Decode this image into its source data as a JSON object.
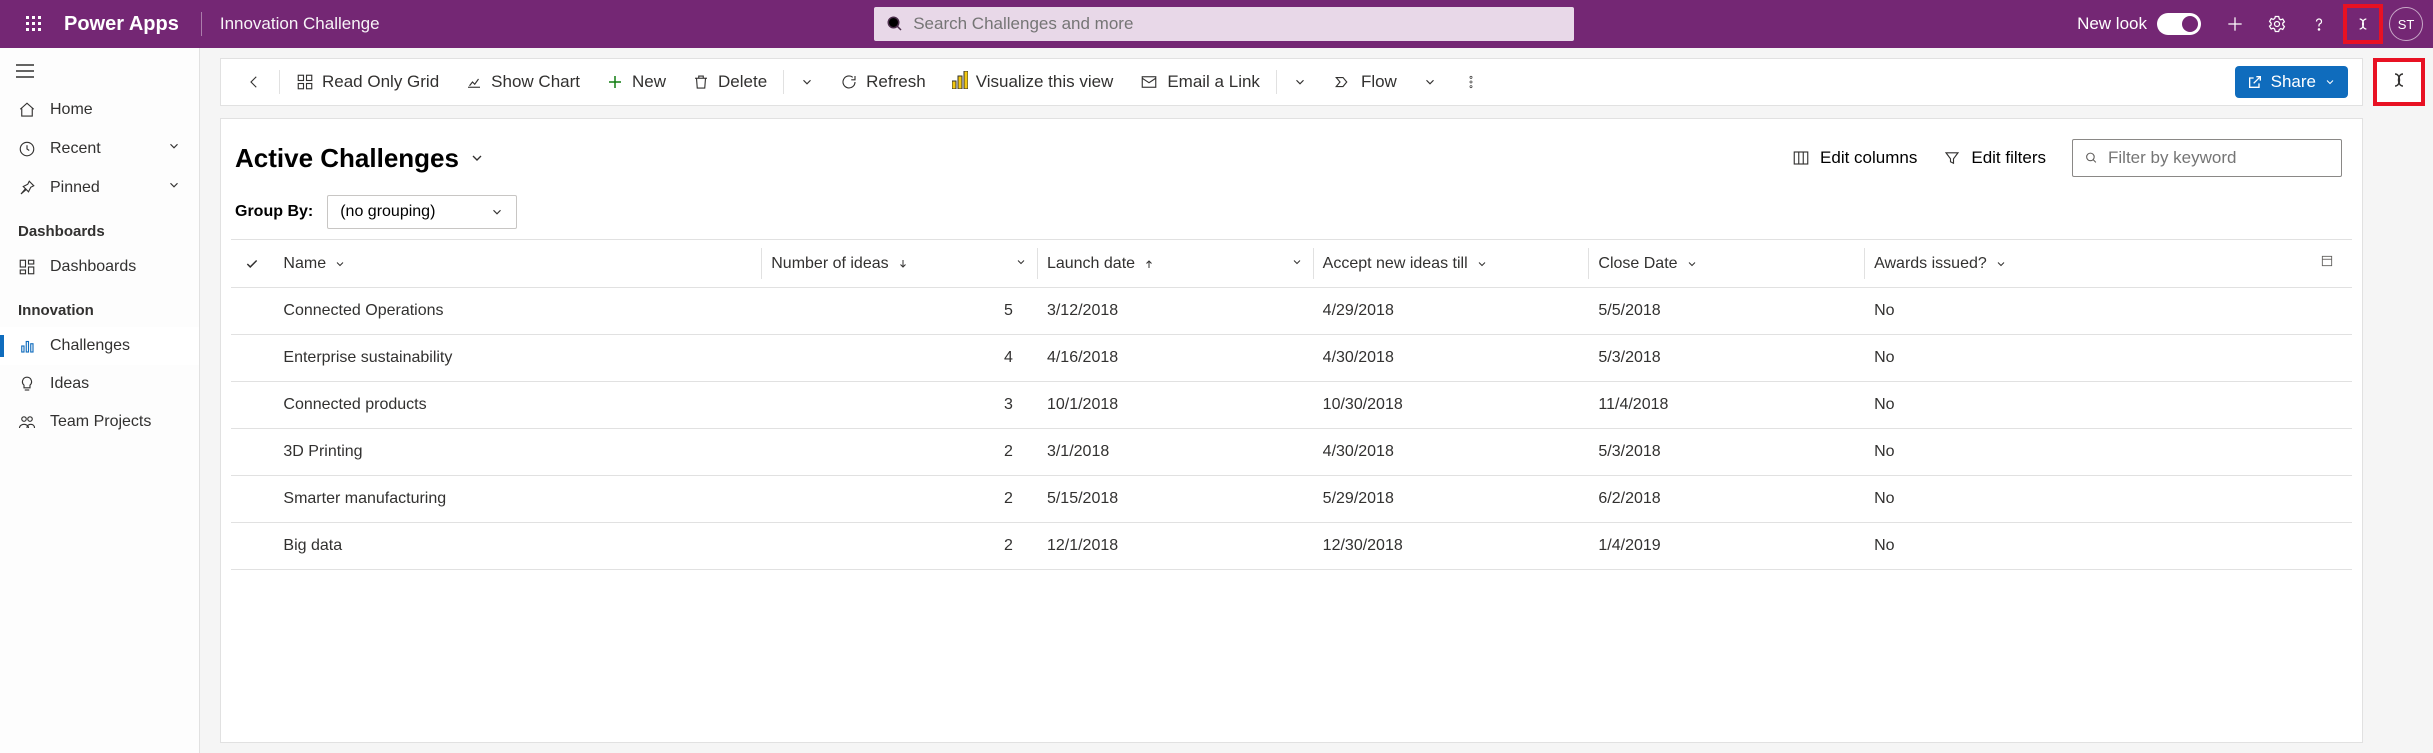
{
  "header": {
    "brand": "Power Apps",
    "app_name": "Innovation Challenge",
    "search_placeholder": "Search Challenges and more",
    "new_look_label": "New look",
    "avatar_initials": "ST"
  },
  "sidebar": {
    "nav": {
      "home": "Home",
      "recent": "Recent",
      "pinned": "Pinned"
    },
    "groups": [
      {
        "header": "Dashboards",
        "items": [
          {
            "id": "dashboards",
            "label": "Dashboards",
            "icon": "dashboard-icon",
            "selected": false
          }
        ]
      },
      {
        "header": "Innovation",
        "items": [
          {
            "id": "challenges",
            "label": "Challenges",
            "icon": "challenges-icon",
            "selected": true
          },
          {
            "id": "ideas",
            "label": "Ideas",
            "icon": "ideas-icon",
            "selected": false
          },
          {
            "id": "team-projects",
            "label": "Team Projects",
            "icon": "team-icon",
            "selected": false
          }
        ]
      }
    ]
  },
  "cmdbar": {
    "readonly_grid": "Read Only Grid",
    "show_chart": "Show Chart",
    "new": "New",
    "delete": "Delete",
    "refresh": "Refresh",
    "visualize": "Visualize this view",
    "email": "Email a Link",
    "flow": "Flow",
    "share": "Share"
  },
  "view": {
    "title": "Active Challenges",
    "edit_columns": "Edit columns",
    "edit_filters": "Edit filters",
    "filter_placeholder": "Filter by keyword",
    "group_by_label": "Group By:",
    "group_by_value": "(no grouping)"
  },
  "columns": {
    "name": "Name",
    "num_ideas": "Number of ideas",
    "launch": "Launch date",
    "accept": "Accept new ideas till",
    "close": "Close Date",
    "awards": "Awards issued?"
  },
  "rows": [
    {
      "name": "Connected Operations",
      "num_ideas": "5",
      "launch": "3/12/2018",
      "accept": "4/29/2018",
      "close": "5/5/2018",
      "awards": "No"
    },
    {
      "name": "Enterprise sustainability",
      "num_ideas": "4",
      "launch": "4/16/2018",
      "accept": "4/30/2018",
      "close": "5/3/2018",
      "awards": "No"
    },
    {
      "name": "Connected products",
      "num_ideas": "3",
      "launch": "10/1/2018",
      "accept": "10/30/2018",
      "close": "11/4/2018",
      "awards": "No"
    },
    {
      "name": "3D Printing",
      "num_ideas": "2",
      "launch": "3/1/2018",
      "accept": "4/30/2018",
      "close": "5/3/2018",
      "awards": "No"
    },
    {
      "name": "Smarter manufacturing",
      "num_ideas": "2",
      "launch": "5/15/2018",
      "accept": "5/29/2018",
      "close": "6/2/2018",
      "awards": "No"
    },
    {
      "name": "Big data",
      "num_ideas": "2",
      "launch": "12/1/2018",
      "accept": "12/30/2018",
      "close": "1/4/2019",
      "awards": "No"
    }
  ]
}
